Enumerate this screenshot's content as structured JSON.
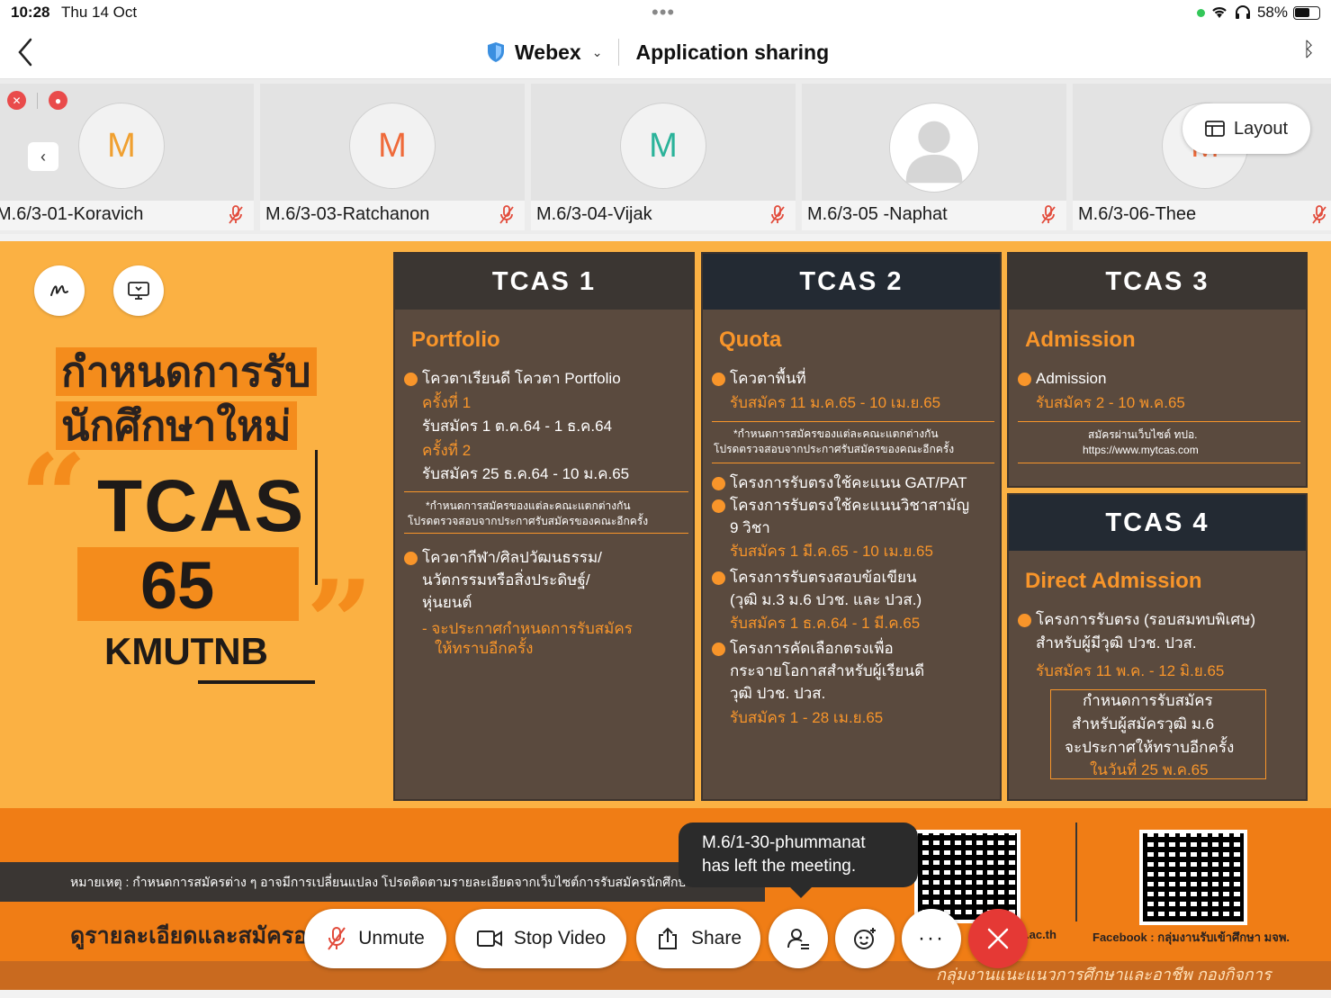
{
  "status_bar": {
    "time": "10:28",
    "date": "Thu 14 Oct",
    "battery": "58%"
  },
  "nav": {
    "app": "Webex",
    "title": "Application sharing"
  },
  "participants": [
    {
      "name": "M.6/3-01-Koravich",
      "initial": "M",
      "color": "#f0a030",
      "muted": true
    },
    {
      "name": "M.6/3-03-Ratchanon",
      "initial": "M",
      "color": "#ef6a3a",
      "muted": true
    },
    {
      "name": "M.6/3-04-Vijak",
      "initial": "M",
      "color": "#2bb39a",
      "muted": true
    },
    {
      "name": "M.6/3-05 -Naphat",
      "initial": "",
      "color": "#d9d9d9",
      "muted": true
    },
    {
      "name": "M.6/3-06-Thee",
      "initial": "M",
      "color": "#ef6a3a",
      "muted": true
    }
  ],
  "layout_button": "Layout",
  "poster": {
    "heading_line1": "กำหนดการรับ",
    "heading_line2": "นักศึกษาใหม่",
    "tcas": "TCAS",
    "year": "65",
    "univ": "KMUTNB",
    "note": "หมายเหตุ : กำหนดการสมัครต่าง ๆ อาจมีการเปลี่ยนแปลง โปรดติดตามรายละเอียดจากเว็บไซต์การรับสมัครนักศึกษาของ",
    "cta": "ดูรายละเอียดและสมัครออ",
    "site_suffix": ".ac.th",
    "facebook": "Facebook : กลุ่มงานรับเข้าศึกษา มจพ.",
    "credit": "กลุ่มงานแนะแนวการศึกษาและอาชีพ กองกิจการนักศึกษา มจพ.",
    "tcas1": {
      "head": "TCAS 1",
      "sub": "Portfolio",
      "b1": "โควตาเรียนดี โควตา Portfolio",
      "r1": "ครั้งที่ 1",
      "d1": "รับสมัคร 1 ต.ค.64 - 1 ธ.ค.64",
      "r2": "ครั้งที่ 2",
      "d2": "รับสมัคร 25 ธ.ค.64 - 10 ม.ค.65",
      "n1": "*กำหนดการสมัครของแต่ละคณะแตกต่างกัน",
      "n2": "โปรดตรวจสอบจากประกาศรับสมัครของคณะอีกครั้ง",
      "b2a": "โควตากีฬา/ศิลปวัฒนธรรม/",
      "b2b": "นวัตกรรมหรือสิ่งประดิษฐ์/",
      "b2c": "หุ่นยนต์",
      "a1": "- จะประกาศกำหนดการรับสมัคร",
      "a2": "ให้ทราบอีกครั้ง"
    },
    "tcas2": {
      "head": "TCAS 2",
      "sub": "Quota",
      "b1": "โควตาพื้นที่",
      "d1": "รับสมัคร 11 ม.ค.65 - 10 เม.ย.65",
      "n1": "*กำหนดการสมัครของแต่ละคณะแตกต่างกัน",
      "n2": "โปรดตรวจสอบจากประกาศรับสมัครของคณะอีกครั้ง",
      "b2": "โครงการรับตรงใช้คะแนน GAT/PAT",
      "b3a": "โครงการรับตรงใช้คะแนนวิชาสามัญ",
      "b3b": "9 วิชา",
      "d3": "รับสมัคร 1 มี.ค.65 - 10 เม.ย.65",
      "b4a": "โครงการรับตรงสอบข้อเขียน",
      "b4b": "(วุฒิ ม.3 ม.6 ปวช. และ ปวส.)",
      "d4": "รับสมัคร 1 ธ.ค.64 - 1 มี.ค.65",
      "b5a": "โครงการคัดเลือกตรงเพื่อ",
      "b5b": "กระจายโอกาสสำหรับผู้เรียนดี",
      "b5c": "วุฒิ ปวช. ปวส.",
      "d5": "รับสมัคร 1 - 28 เม.ย.65"
    },
    "tcas3": {
      "head": "TCAS 3",
      "sub": "Admission",
      "b1": "Admission",
      "d1": "รับสมัคร 2 - 10 พ.ค.65",
      "n1": "สมัครผ่านเว็บไซต์ ทปอ.",
      "n2": "https://www.mytcas.com"
    },
    "tcas4": {
      "head": "TCAS 4",
      "sub": "Direct Admission",
      "b1": "โครงการรับตรง (รอบสมทบพิเศษ)",
      "b1b": "สำหรับผู้มีวุฒิ ปวช. ปวส.",
      "d1": "รับสมัคร 11 พ.ค. - 12 มิ.ย.65",
      "x1": "กำหนดการรับสมัคร",
      "x2": "สำหรับผู้สมัครวุฒิ ม.6",
      "x3": "จะประกาศให้ทราบอีกครั้ง",
      "x4": "ในวันที่ 25 พ.ค.65"
    }
  },
  "toast": {
    "line1": "M.6/1-30-phummanat",
    "line2": "has left the meeting."
  },
  "controls": {
    "unmute": "Unmute",
    "stop_video": "Stop Video",
    "share": "Share"
  },
  "colors": {
    "poster_bg": "#fbb143",
    "accent": "#f8952a",
    "end_call": "#e53935"
  }
}
